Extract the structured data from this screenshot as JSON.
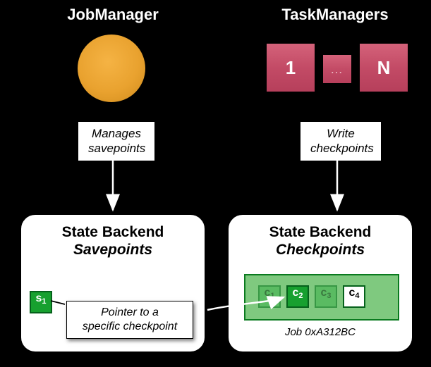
{
  "top": {
    "jobmanager_title": "JobManager",
    "taskmanager_title": "TaskManagers",
    "tm_first": "1",
    "tm_dots": "…",
    "tm_last": "N",
    "jm_caption": "Manages\nsavepoints",
    "tm_caption": "Write\ncheckpoints"
  },
  "left_panel": {
    "title_line1": "State Backend",
    "title_line2": "Savepoints",
    "chip_main": "s",
    "chip_sub": "1",
    "tooltip": "Pointer to a\nspecific checkpoint"
  },
  "right_panel": {
    "title_line1": "State Backend",
    "title_line2": "Checkpoints",
    "chips": [
      {
        "main": "c",
        "sub": "1"
      },
      {
        "main": "c",
        "sub": "2"
      },
      {
        "main": "c",
        "sub": "3"
      },
      {
        "main": "c",
        "sub": "4"
      }
    ],
    "job_id": "Job 0xA312BC"
  }
}
